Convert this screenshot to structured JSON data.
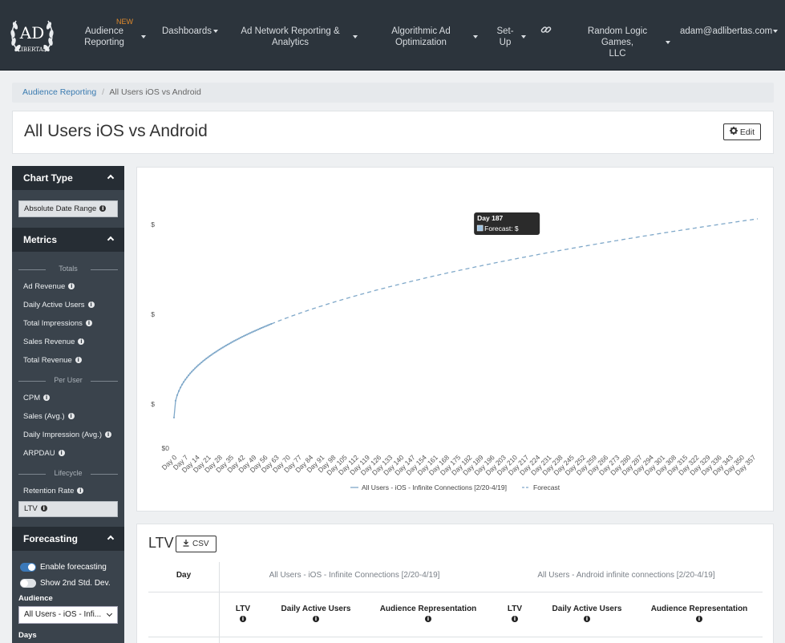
{
  "navbar": {
    "logo_text_top": "AD",
    "logo_text_bottom": "LIBERTAS",
    "new_badge": "NEW",
    "items": [
      {
        "label_line1": "Audience",
        "label_line2": "Reporting"
      },
      {
        "label_line1": "Dashboards",
        "label_line2": ""
      },
      {
        "label_line1": "Ad Network Reporting &",
        "label_line2": "Analytics"
      },
      {
        "label_line1": "Algorithmic Ad",
        "label_line2": "Optimization"
      },
      {
        "label_line1": "Set-",
        "label_line2": "Up"
      },
      {
        "label_line1": "Random Logic Games,",
        "label_line2": "LLC"
      },
      {
        "label_line1": "adam@adlibertas.com",
        "label_line2": ""
      }
    ],
    "link_icon": "link-icon"
  },
  "breadcrumb": {
    "parent": "Audience Reporting",
    "separator": "/",
    "current": "All Users iOS vs Android"
  },
  "page": {
    "title": "All Users iOS vs Android",
    "edit_label": "Edit",
    "edit_icon": "gear-icon"
  },
  "sidebar": {
    "chart_type": {
      "header": "Chart Type",
      "button": "Absolute Date Range"
    },
    "metrics": {
      "header": "Metrics",
      "groups": [
        {
          "label": "Totals",
          "items": [
            "Ad Revenue",
            "Daily Active Users",
            "Total Impressions",
            "Sales Revenue",
            "Total Revenue"
          ]
        },
        {
          "label": "Per User",
          "items": [
            "CPM",
            "Sales (Avg.)",
            "Daily Impression (Avg.)",
            "ARPDAU"
          ]
        },
        {
          "label": "Lifecycle",
          "items": [
            "Retention Rate",
            "LTV"
          ]
        }
      ],
      "active": "LTV"
    },
    "forecasting": {
      "header": "Forecasting",
      "enable_label": "Enable forecasting",
      "enable_on": true,
      "stddev_label": "Show 2nd Std. Dev.",
      "stddev_on": false,
      "audience_label": "Audience",
      "audience_value": "All Users - iOS - Infi...",
      "days_label": "Days"
    }
  },
  "chart_data": {
    "type": "line",
    "y_tick_labels": [
      "$0",
      "$",
      "$",
      "$"
    ],
    "x_tick_labels": [
      "Day 0",
      "Day 7",
      "Day 14",
      "Day 21",
      "Day 28",
      "Day 35",
      "Day 42",
      "Day 49",
      "Day 56",
      "Day 63",
      "Day 70",
      "Day 77",
      "Day 84",
      "Day 91",
      "Day 98",
      "Day 105",
      "Day 112",
      "Day 119",
      "Day 126",
      "Day 133",
      "Day 140",
      "Day 147",
      "Day 154",
      "Day 161",
      "Day 168",
      "Day 175",
      "Day 182",
      "Day 189",
      "Day 196",
      "Day 203",
      "Day 210",
      "Day 217",
      "Day 224",
      "Day 231",
      "Day 238",
      "Day 245",
      "Day 252",
      "Day 259",
      "Day 266",
      "Day 273",
      "Day 280",
      "Day 287",
      "Day 294",
      "Day 301",
      "Day 308",
      "Day 315",
      "Day 322",
      "Day 329",
      "Day 336",
      "Day 343",
      "Day 350",
      "Day 357"
    ],
    "x_range": [
      0,
      360
    ],
    "series": [
      {
        "name": "All Users - iOS - Infinite Connections [2/20-4/19]",
        "style": "solid",
        "color": "#7fa8c9",
        "x_range": [
          0,
          60
        ]
      },
      {
        "name": "Forecast",
        "style": "dashed",
        "color": "#7fa8c9",
        "x_range": [
          60,
          360
        ]
      }
    ],
    "tooltip": {
      "title": "Day 187",
      "label": "Forecast: $",
      "day": 187
    },
    "grid": false,
    "legend": "bottom"
  },
  "ltv_table": {
    "title": "LTV",
    "csv_label": "CSV",
    "csv_icon": "download-icon",
    "day_header": "Day",
    "series_headers": [
      "All Users - iOS - Infinite Connections [2/20-4/19]",
      "All Users - Android infinite connections [2/20-4/19]"
    ],
    "column_headers": [
      "LTV",
      "Daily Active Users",
      "Audience Representation",
      "LTV",
      "Daily Active Users",
      "Audience Representation"
    ]
  }
}
